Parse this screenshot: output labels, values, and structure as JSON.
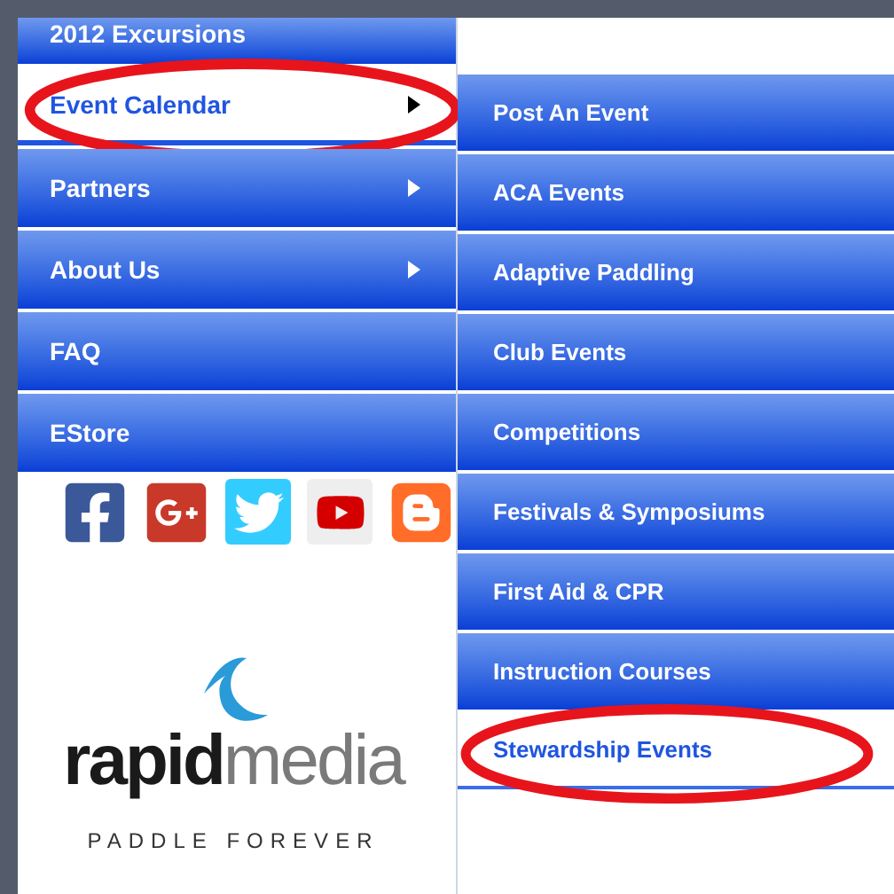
{
  "menu": [
    {
      "label": "2012 Excursions",
      "selected": false,
      "has_submenu": false,
      "circled": false
    },
    {
      "label": "Event Calendar",
      "selected": true,
      "has_submenu": true,
      "circled": true
    },
    {
      "label": "Partners",
      "selected": false,
      "has_submenu": true,
      "circled": false
    },
    {
      "label": "About Us",
      "selected": false,
      "has_submenu": true,
      "circled": false
    },
    {
      "label": "FAQ",
      "selected": false,
      "has_submenu": false,
      "circled": false
    },
    {
      "label": "EStore",
      "selected": false,
      "has_submenu": false,
      "circled": false
    }
  ],
  "social": [
    {
      "kind": "facebook"
    },
    {
      "kind": "googleplus"
    },
    {
      "kind": "twitter"
    },
    {
      "kind": "youtube"
    },
    {
      "kind": "blogger"
    }
  ],
  "logo": {
    "primary": "rapid",
    "secondary": "media",
    "tagline": "PADDLE FOREVER"
  },
  "submenu": [
    {
      "label": "Post An Event",
      "selected": false,
      "circled": false
    },
    {
      "label": "ACA Events",
      "selected": false,
      "circled": false
    },
    {
      "label": "Adaptive Paddling",
      "selected": false,
      "circled": false
    },
    {
      "label": "Club Events",
      "selected": false,
      "circled": false
    },
    {
      "label": "Competitions",
      "selected": false,
      "circled": false
    },
    {
      "label": "Festivals & Symposiums",
      "selected": false,
      "circled": false
    },
    {
      "label": "First Aid & CPR",
      "selected": false,
      "circled": false
    },
    {
      "label": "Instruction Courses",
      "selected": false,
      "circled": false
    },
    {
      "label": "Stewardship Events",
      "selected": true,
      "circled": true
    }
  ]
}
